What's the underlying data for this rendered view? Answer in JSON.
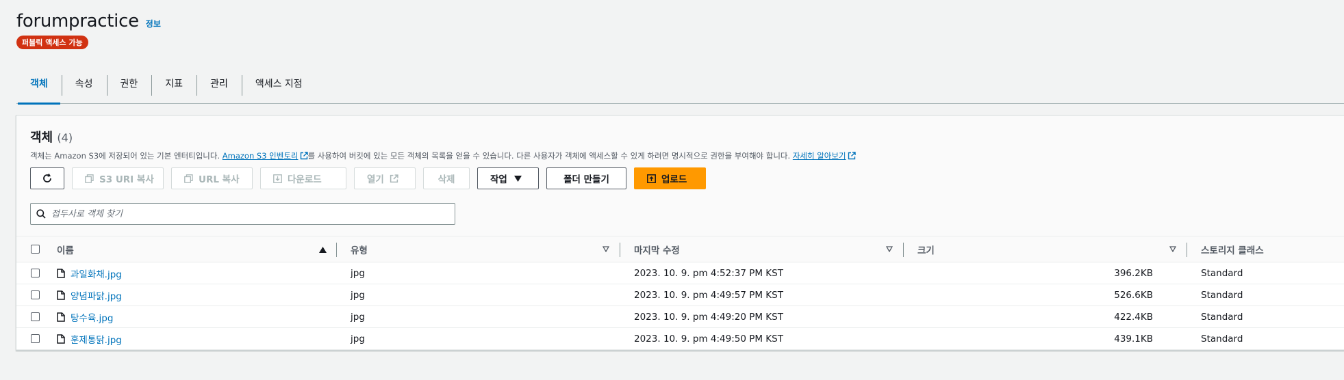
{
  "header": {
    "title": "forumpractice",
    "info_link": "정보",
    "public_badge": "퍼블릭 액세스 가능"
  },
  "tabs": [
    {
      "label": "객체",
      "active": true
    },
    {
      "label": "속성"
    },
    {
      "label": "권한"
    },
    {
      "label": "지표"
    },
    {
      "label": "관리"
    },
    {
      "label": "액세스 지점"
    }
  ],
  "objects_panel": {
    "title": "객체",
    "count": "(4)",
    "desc_1": "객체는 Amazon S3에 저장되어 있는 기본 엔터티입니다. ",
    "desc_link_1": "Amazon S3 인벤토리",
    "desc_2": "를 사용하여 버킷에 있는 모든 객체의 목록을 얻을 수 있습니다. 다른 사용자가 객체에 액세스할 수 있게 하려면 명시적으로 권한을 부여해야 합니다. ",
    "desc_link_2": "자세히 알아보기"
  },
  "toolbar": {
    "s3_uri_copy": "S3 URI 복사",
    "url_copy": "URL 복사",
    "download": "다운로드",
    "open": "열기",
    "delete": "삭제",
    "actions": "작업",
    "create_folder": "폴더 만들기",
    "upload": "업로드"
  },
  "search": {
    "placeholder": "접두사로 객체 찾기"
  },
  "table": {
    "columns": {
      "name": "이름",
      "type": "유형",
      "last_modified": "마지막 수정",
      "size": "크기",
      "storage_class": "스토리지 클래스"
    },
    "rows": [
      {
        "name": "과일화채.jpg",
        "type": "jpg",
        "last_modified": "2023. 10. 9. pm 4:52:37 PM KST",
        "size": "396.2KB",
        "storage_class": "Standard"
      },
      {
        "name": "양념파닭.jpg",
        "type": "jpg",
        "last_modified": "2023. 10. 9. pm 4:49:57 PM KST",
        "size": "526.6KB",
        "storage_class": "Standard"
      },
      {
        "name": "탕수육.jpg",
        "type": "jpg",
        "last_modified": "2023. 10. 9. pm 4:49:20 PM KST",
        "size": "422.4KB",
        "storage_class": "Standard"
      },
      {
        "name": "훈제통닭.jpg",
        "type": "jpg",
        "last_modified": "2023. 10. 9. pm 4:49:50 PM KST",
        "size": "439.1KB",
        "storage_class": "Standard"
      }
    ]
  },
  "colors": {
    "accent": "#0073bb",
    "badge": "#d13212",
    "upload": "#ff9900"
  }
}
